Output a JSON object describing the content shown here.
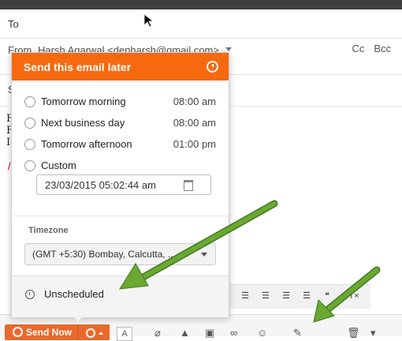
{
  "compose": {
    "to_label": "To",
    "from_label": "From",
    "from_value": "Harsh Agarwal <denharsh@gmail.com>",
    "cc_label": "Cc",
    "bcc_label": "Bcc",
    "subject_label": "S",
    "body_lines": [
      "F",
      "F",
      "I"
    ],
    "body_red": "/"
  },
  "popup": {
    "title": "Send this email later",
    "title_icon": "clock-icon",
    "options": [
      {
        "label": "Tomorrow morning",
        "time": "08:00 am"
      },
      {
        "label": "Next business day",
        "time": "08:00 am"
      },
      {
        "label": "Tomorrow afternoon",
        "time": "01:00 pm"
      },
      {
        "label": "Custom",
        "time": ""
      }
    ],
    "datetime_value": "23/03/2015 05:02:44 am",
    "timezone_label": "Timezone",
    "timezone_value": "(GMT +5:30) Bombay, Calcutta, ...",
    "footer_label": "Unscheduled"
  },
  "toolbar": {
    "send_label": "Send Now",
    "format_label": "A"
  },
  "colors": {
    "accent": "#f7690f",
    "send_button": "#e9692c",
    "arrow": "#6aa832"
  }
}
